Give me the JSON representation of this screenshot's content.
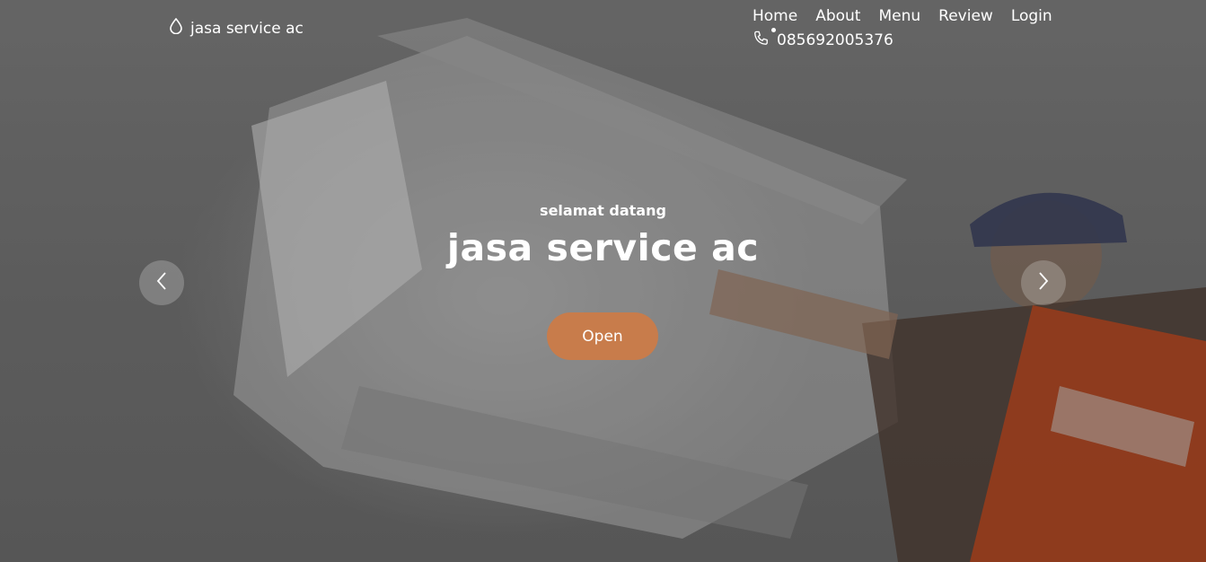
{
  "brand": {
    "name": "jasa service ac",
    "icon": "droplet-icon"
  },
  "nav": {
    "items": [
      "Home",
      "About",
      "Menu",
      "Review",
      "Login"
    ]
  },
  "contact": {
    "phone": "085692005376",
    "icon": "phone-icon"
  },
  "hero": {
    "tagline": "selamat datang",
    "headline": "jasa service ac",
    "cta_label": "Open",
    "prev_icon": "chevron-left-icon",
    "next_icon": "chevron-right-icon"
  },
  "colors": {
    "accent": "#c87c4b",
    "text": "#ffffff"
  }
}
